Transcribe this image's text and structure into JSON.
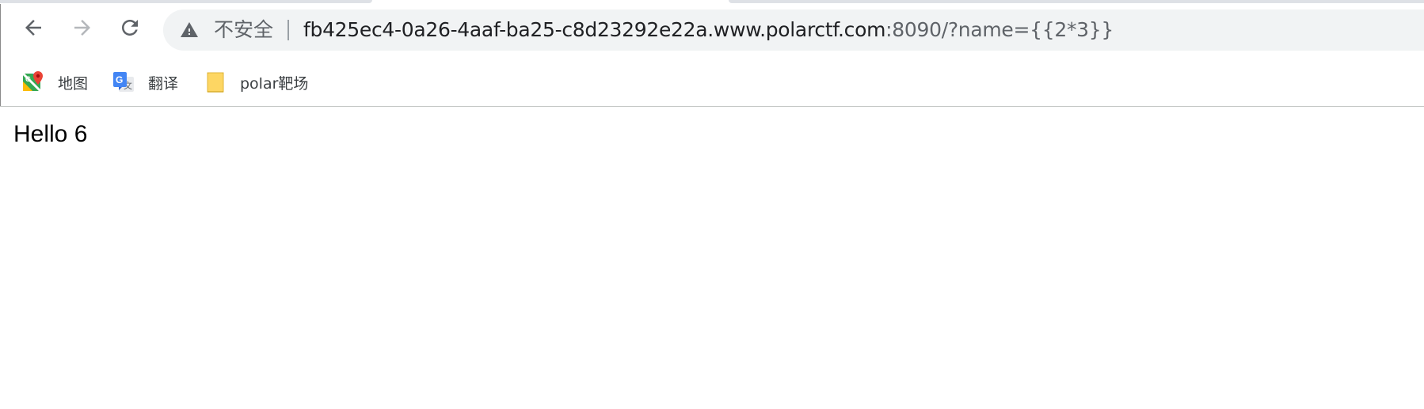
{
  "toolbar": {
    "back_icon": "arrow-left-icon",
    "forward_icon": "arrow-right-icon",
    "reload_icon": "reload-icon"
  },
  "omnibox": {
    "security_icon": "warning-triangle-icon",
    "security_label": "不安全",
    "url_host": "fb425ec4-0a26-4aaf-ba25-c8d23292e22a.www.polarctf.com",
    "url_rest": ":8090/?name={{2*3}}"
  },
  "bookmarks": [
    {
      "label": "地图",
      "icon": "maps-icon"
    },
    {
      "label": "翻译",
      "icon": "translate-icon"
    },
    {
      "label": "polar靶场",
      "icon": "folder-icon"
    }
  ],
  "page": {
    "greeting": "Hello 6"
  },
  "colors": {
    "omnibox_bg": "#f1f3f4",
    "text_primary": "#202124",
    "text_secondary": "#5f6368",
    "folder_yellow": "#fdd663"
  }
}
